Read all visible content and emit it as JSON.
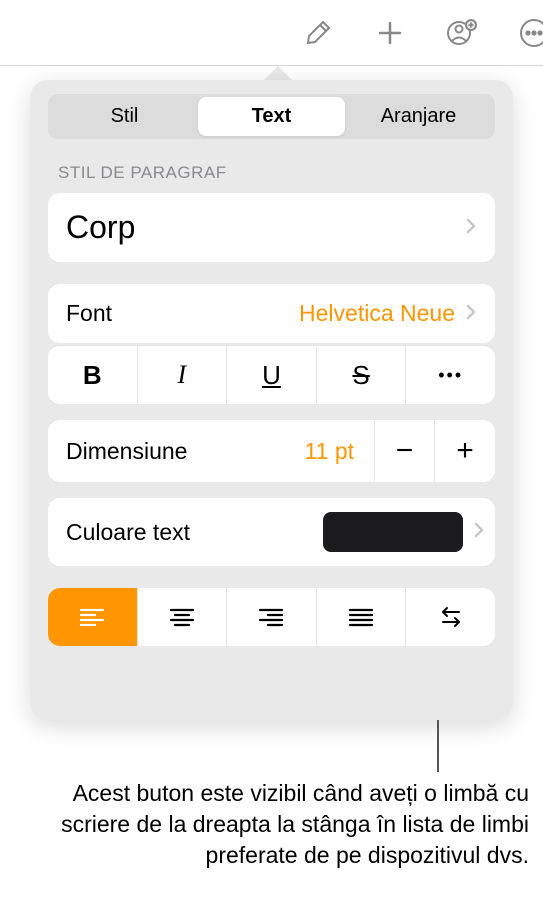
{
  "toolbar": {
    "icons": [
      "brush",
      "plus",
      "collaborate",
      "more"
    ]
  },
  "tabs": {
    "items": [
      {
        "label": "Stil",
        "active": false
      },
      {
        "label": "Text",
        "active": true
      },
      {
        "label": "Aranjare",
        "active": false
      }
    ]
  },
  "section_label": "STIL DE PARAGRAF",
  "paragraph_style": "Corp",
  "font": {
    "label": "Font",
    "value": "Helvetica Neue"
  },
  "style_buttons": {
    "bold": "B",
    "italic": "I",
    "underline": "U",
    "strike": "S",
    "more": "•••"
  },
  "size": {
    "label": "Dimensiune",
    "value": "11 pt",
    "minus": "−",
    "plus": "+"
  },
  "text_color": {
    "label": "Culoare text",
    "value": "#1c1c1e"
  },
  "alignment": {
    "active_index": 0
  },
  "callout": "Acest buton este vizibil când aveți o limbă cu scriere de la dreapta la stânga în lista de limbi preferate de pe dispozitivul dvs."
}
